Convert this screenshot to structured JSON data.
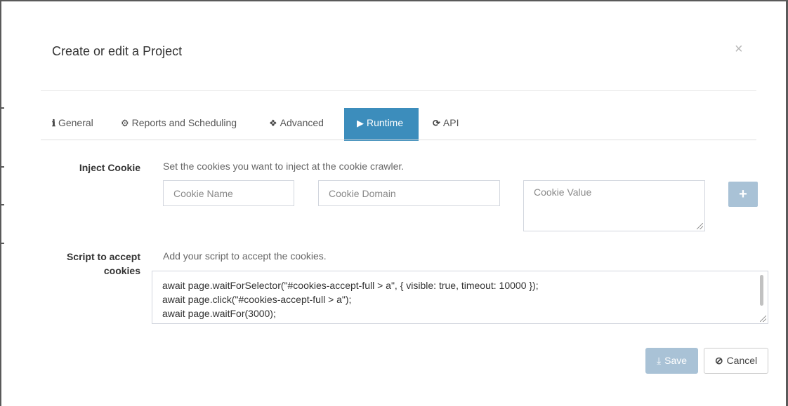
{
  "modal": {
    "title": "Create or edit a Project",
    "close_glyph": "×"
  },
  "tabs": [
    {
      "label": "General",
      "icon": "info-icon",
      "glyph": "ℹ"
    },
    {
      "label": "Reports and Scheduling",
      "icon": "cogs-icon",
      "glyph": "⚙"
    },
    {
      "label": "Advanced",
      "icon": "cubes-icon",
      "glyph": "❖"
    },
    {
      "label": "Runtime",
      "icon": "play-icon",
      "glyph": "▶",
      "active": true
    },
    {
      "label": "API",
      "icon": "refresh-icon",
      "glyph": "⟳"
    }
  ],
  "inject_cookie": {
    "label": "Inject Cookie",
    "help": "Set the cookies you want to inject at the cookie crawler.",
    "name_placeholder": "Cookie Name",
    "domain_placeholder": "Cookie Domain",
    "value_placeholder": "Cookie Value",
    "add_glyph": "+"
  },
  "script": {
    "label_line1": "Script to accept",
    "label_line2": "cookies",
    "help": "Add your script to accept the cookies.",
    "lines": [
      "await page.waitForSelector(\"#cookies-accept-full > a\", { visible: true, timeout: 10000 });",
      "await page.click(\"#cookies-accept-full > a\");",
      "await page.waitFor(3000);"
    ]
  },
  "footer": {
    "save_label": "Save",
    "save_icon": "download-icon",
    "cancel_label": "Cancel",
    "cancel_icon": "ban-icon"
  },
  "colors": {
    "accent": "#3c8dbc",
    "disabled_button": "#a9c2d6"
  }
}
